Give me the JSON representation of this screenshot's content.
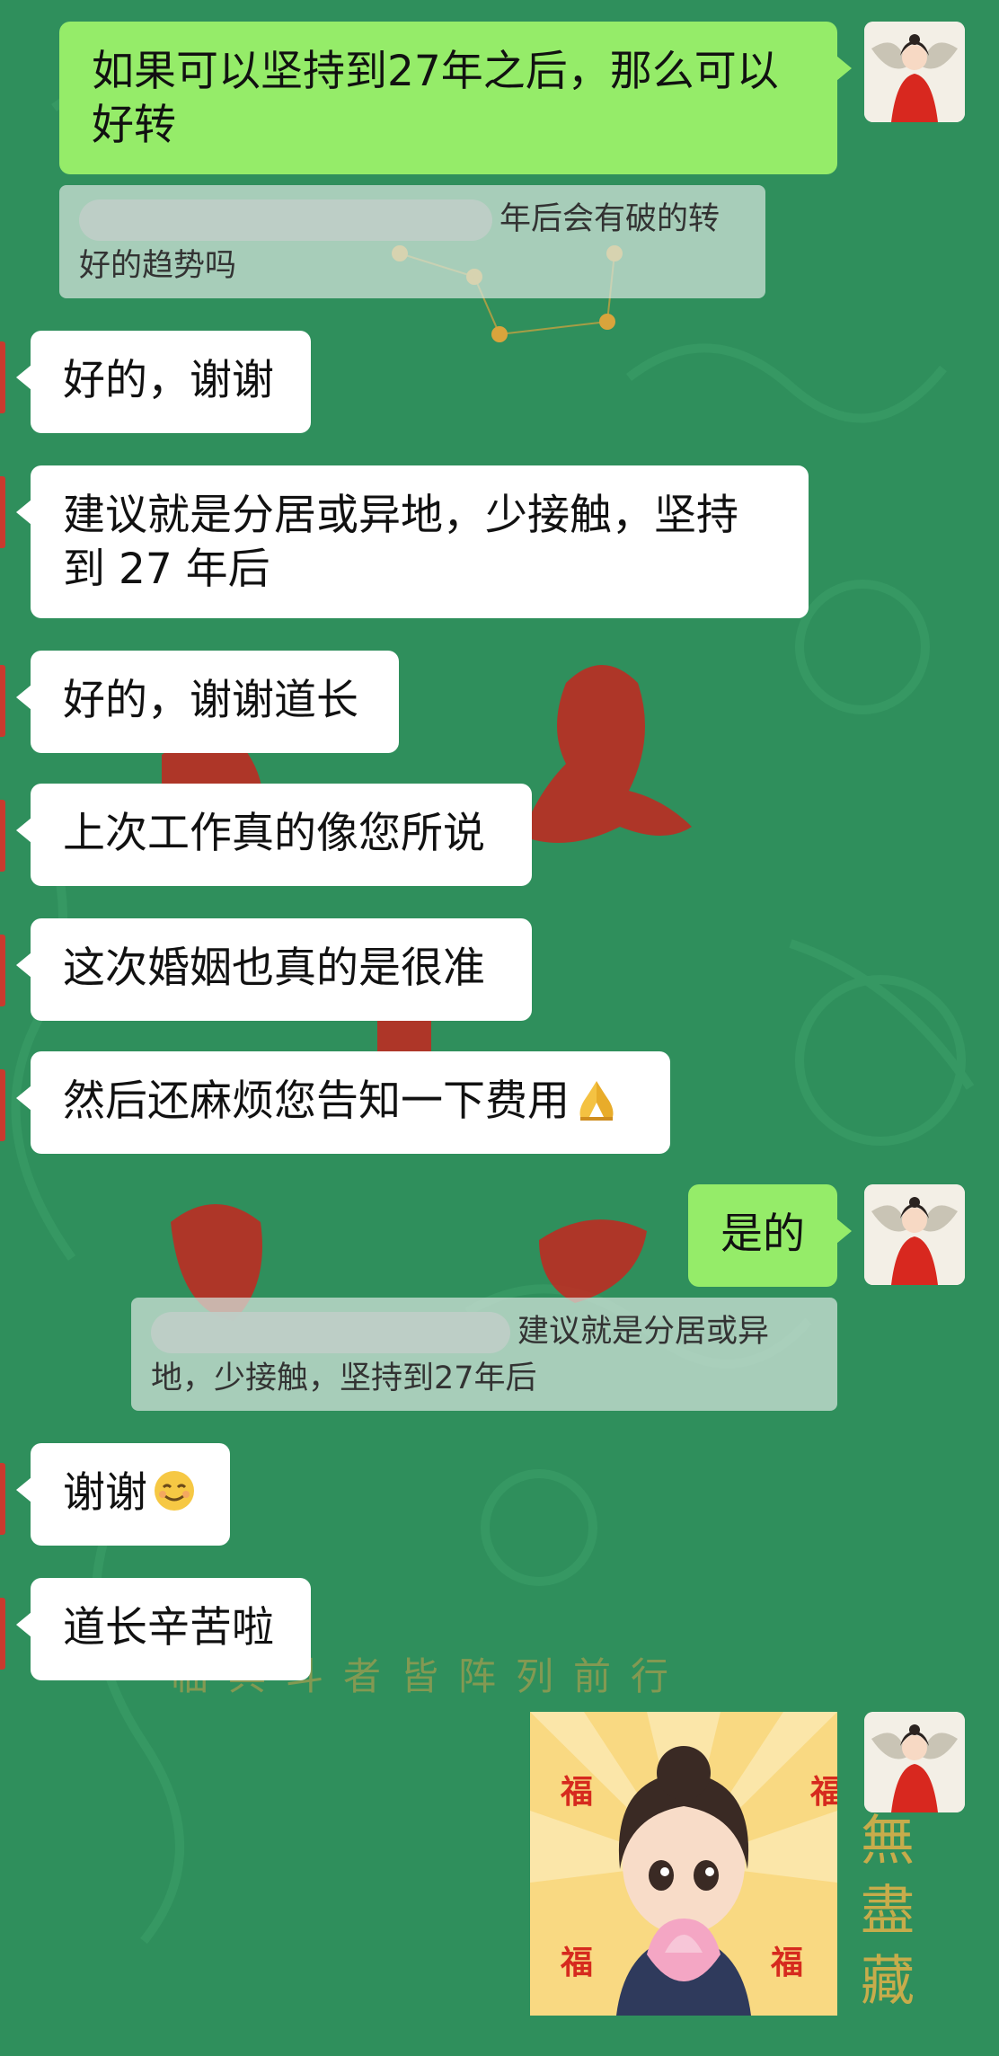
{
  "messages": {
    "m1": "如果可以坚持到27年之后，那么可以好转",
    "q1": "年后会有破的转好的趋势吗",
    "m2": "好的，谢谢",
    "m3": "建议就是分居或异地，少接触，坚持到 27 年后",
    "m4": "好的，谢谢道长",
    "m5": "上次工作真的像您所说",
    "m6": "这次婚姻也真的是很准",
    "m7": "然后还麻烦您告知一下费用",
    "m8": "是的",
    "q2": "建议就是分居或异地，少接触，坚持到27年后",
    "m9": "谢谢",
    "m10": "道长辛苦啦"
  },
  "icons": {
    "m7_emoji": "folded-hands-icon",
    "m9_emoji": "smiling-face-icon"
  },
  "sticker": {
    "fu_char": "福"
  },
  "background": {
    "motto": "临兵斗者皆阵列前行",
    "calligraphy_right": "無盡藏"
  },
  "colors": {
    "chat_bg": "#2f8f5c",
    "outgoing_bubble": "#95ec69",
    "incoming_bubble": "#ffffff",
    "quote_bg": "#d6e4de"
  }
}
